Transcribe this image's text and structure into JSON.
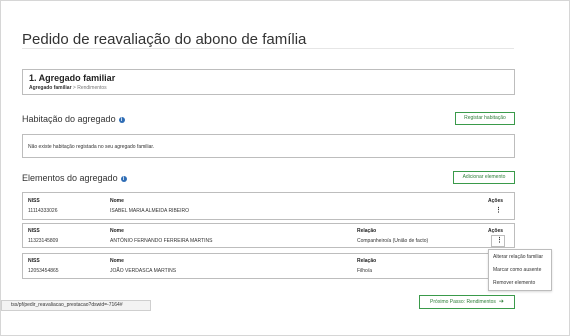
{
  "page": {
    "title": "Pedido de reavaliação do abono de família"
  },
  "step": {
    "title": "1. Agregado familiar",
    "breadcrumb_current": "Agregado familiar",
    "breadcrumb_sep": ">",
    "breadcrumb_next": "Rendimentos"
  },
  "housing": {
    "title": "Habitação do agregado",
    "info_icon": "i",
    "register_button": "Registar habitação",
    "empty_text": "Não existe habitação registada no seu agregado familiar."
  },
  "elements": {
    "title": "Elementos do agregado",
    "info_icon": "i",
    "add_button": "Adicionar elemento",
    "columns": {
      "niss": "NISS",
      "name": "Nome",
      "relation": "Relação",
      "actions": "Ações"
    },
    "rows": [
      {
        "niss": "11114333026",
        "name": "ISABEL MARIA ALMEIDA RIBEIRO",
        "relation": ""
      },
      {
        "niss": "11323145809",
        "name": "ANTÓNIO FERNANDO FERREIRA MARTINS",
        "relation": "Companheiro/a (União de facto)"
      },
      {
        "niss": "12053454865",
        "name": "JOÃO VERDASCA MARTINS",
        "relation": "Filho/a"
      }
    ],
    "kebab_symbol": "⋮"
  },
  "actions_menu": {
    "items": [
      "Alterar relação familiar",
      "Marcar como ausente",
      "Remover elemento"
    ]
  },
  "footer": {
    "next_button": "Próximo Passo: Rendimentos",
    "next_icon": "arrow-right-icon",
    "next_arrow": "➔"
  },
  "status_bar": {
    "url": "tss/pf/pedir_reavaliacao_prestacao?dswid=-7164#"
  },
  "colors": {
    "accent_green": "#3a9a4a",
    "info_blue": "#2f6db5",
    "border": "#bdbdbd"
  }
}
